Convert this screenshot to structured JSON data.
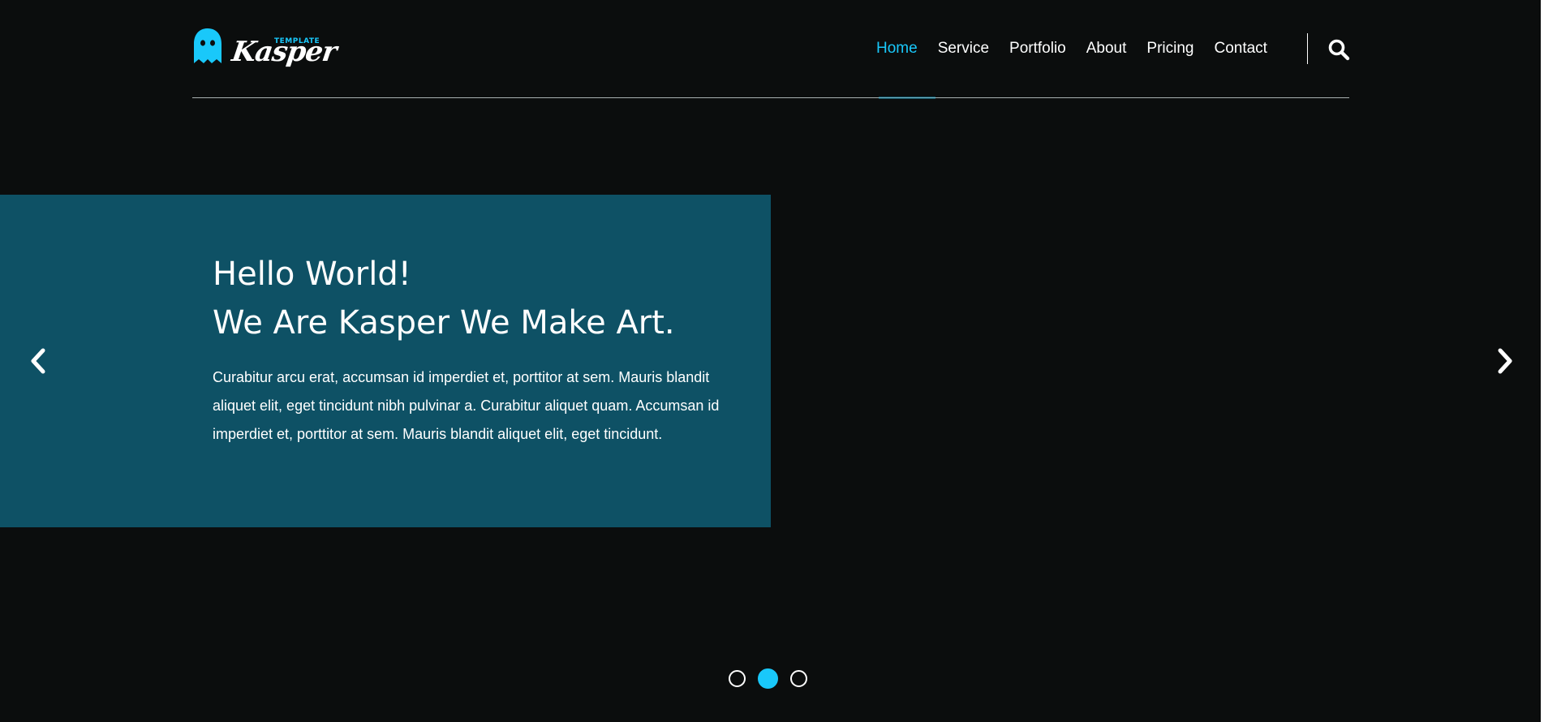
{
  "header": {
    "logo": {
      "tagline": "TEMPLATE",
      "name": "Kasper",
      "icon": "ghost-icon"
    },
    "nav": [
      {
        "label": "Home",
        "active": true
      },
      {
        "label": "Service",
        "active": false
      },
      {
        "label": "Portfolio",
        "active": false
      },
      {
        "label": "About",
        "active": false
      },
      {
        "label": "Pricing",
        "active": false
      },
      {
        "label": "Contact",
        "active": false
      }
    ],
    "search_icon": "search-icon"
  },
  "slider": {
    "heading_line1": "Hello World!",
    "heading_line2": "We Are Kasper We Make Art.",
    "body": "Curabitur arcu erat, accumsan id imperdiet et, porttitor at sem. Mauris blandit aliquet elit, eget tincidunt nibh pulvinar a. Curabitur aliquet quam. Accumsan id imperdiet et, porttitor at sem. Mauris blandit aliquet elit, eget tincidunt.",
    "prev_icon": "chevron-left-icon",
    "next_icon": "chevron-right-icon",
    "slide_count": 3,
    "active_slide": 2
  },
  "colors": {
    "accent": "#19c8fa",
    "background": "#0b0d0d",
    "slide_bg": "#0e5165",
    "text": "#ffffff"
  }
}
